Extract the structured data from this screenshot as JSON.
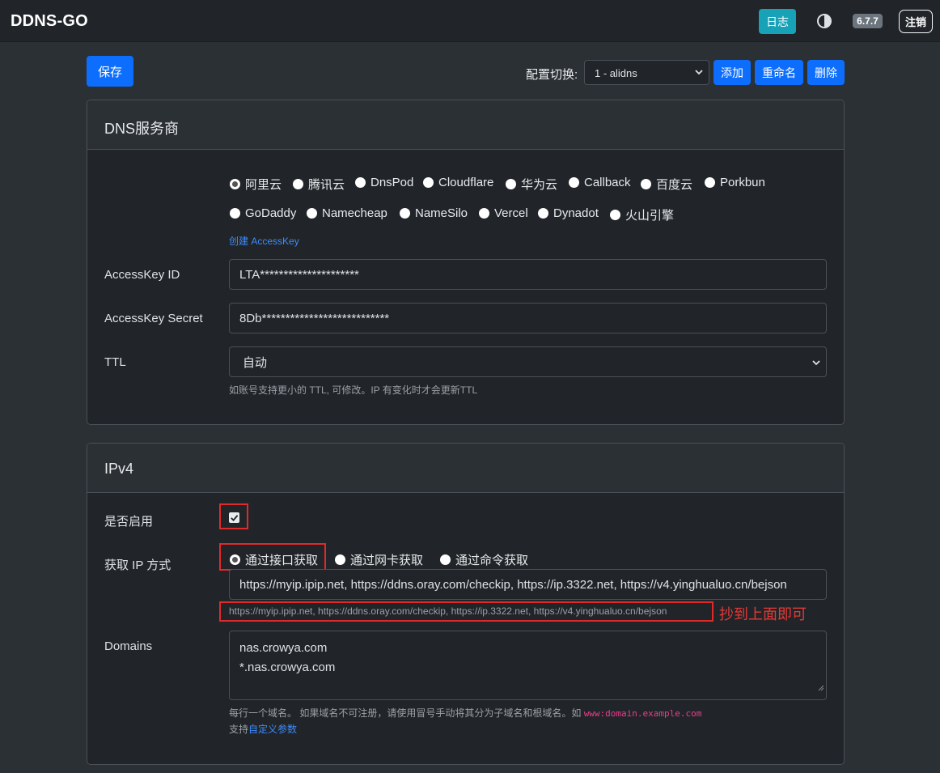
{
  "navbar": {
    "brand": "DDNS-GO",
    "log_label": "日志",
    "theme_icon": "theme-toggle-icon",
    "version": "6.7.7",
    "logout_label": "注销"
  },
  "toolbar": {
    "save_label": "保存",
    "config_switch_label": "配置切换:",
    "config_selected": "1 - alidns",
    "add_label": "添加",
    "rename_label": "重命名",
    "delete_label": "删除"
  },
  "dns_card": {
    "title": "DNS服务商",
    "providers": [
      "阿里云",
      "腾讯云",
      "DnsPod",
      "Cloudflare",
      "华为云",
      "Callback",
      "百度云",
      "Porkbun",
      "GoDaddy",
      "Namecheap",
      "NameSilo",
      "Vercel",
      "Dynadot",
      "火山引擎"
    ],
    "selected_provider": "阿里云",
    "create_key_link": "创建 AccessKey",
    "access_key_id_label": "AccessKey ID",
    "access_key_id_value": "LTA*********************",
    "access_key_secret_label": "AccessKey Secret",
    "access_key_secret_value": "8Db***************************",
    "ttl_label": "TTL",
    "ttl_value": "自动",
    "ttl_help": "如账号支持更小的 TTL, 可修改。IP 有变化时才会更新TTL"
  },
  "ipv4_card": {
    "title": "IPv4",
    "enable_label": "是否启用",
    "enable_checked": true,
    "method_label": "获取 IP 方式",
    "methods": [
      "通过接口获取",
      "通过网卡获取",
      "通过命令获取"
    ],
    "selected_method": "通过接口获取",
    "url_value": "https://myip.ipip.net, https://ddns.oray.com/checkip, https://ip.3322.net, https://v4.yinghualuo.cn/bejson",
    "url_help": "https://myip.ipip.net, https://ddns.oray.com/checkip, https://ip.3322.net, https://v4.yinghualuo.cn/bejson",
    "annotation": "抄到上面即可",
    "domains_label": "Domains",
    "domains_lines": [
      "nas.crowya.com",
      "*.nas.crowya.com"
    ],
    "domains_help": "每行一个域名。 如果域名不可注册，请使用冒号手动将其分为子域名和根域名。如",
    "domains_help_code": "www:domain.example.com",
    "custom_support_prefix": "支持",
    "custom_support_link": "自定义参数"
  },
  "colors": {
    "primary": "#0d6efd",
    "info": "#17a2b8",
    "annotation_red": "#e02a2a"
  }
}
